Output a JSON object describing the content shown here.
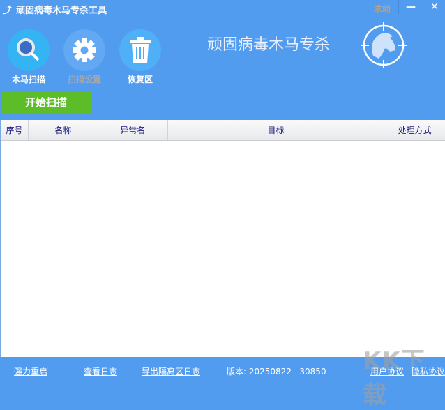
{
  "window": {
    "title": "顽固病毒木马专杀工具",
    "help": "求助",
    "minimize": "—",
    "close": "✕"
  },
  "toolbar": [
    {
      "label": "木马扫描",
      "icon": "magnifier-icon",
      "active": true
    },
    {
      "label": "扫描设置",
      "icon": "gear-icon",
      "active": false
    },
    {
      "label": "恢复区",
      "icon": "trash-icon",
      "active": true
    }
  ],
  "start_button": "开始扫描",
  "brand": {
    "name": "顽固病毒木马专杀"
  },
  "table": {
    "columns": [
      "序号",
      "名称",
      "异常名",
      "目标",
      "处理方式"
    ],
    "rows": []
  },
  "footer": {
    "reboot": "强力重启",
    "view_log": "查看日志",
    "export_log": "导出隔离区日志",
    "version_label": "版本:",
    "version": "20250822",
    "build": "30850",
    "user_agreement": "用户协议",
    "privacy": "隐私协议"
  },
  "watermark": "KK下载",
  "colors": {
    "background": "#529cf0",
    "start": "#5cbd29",
    "help": "#c8a27a"
  }
}
